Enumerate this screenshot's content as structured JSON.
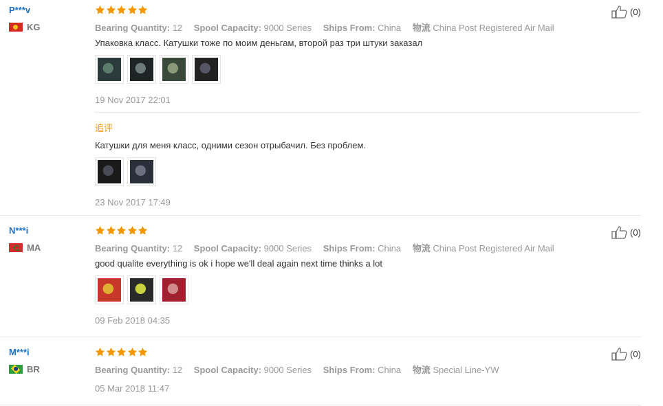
{
  "colors": {
    "star": "#f39800",
    "username": "#1a6fc4",
    "followup": "#f39800",
    "muted": "#999999"
  },
  "attr_labels": {
    "bearing": "Bearing Quantity:",
    "spool": "Spool Capacity:",
    "ships": "Ships From:",
    "logistics": "物流"
  },
  "reviews": [
    {
      "user": "P***v",
      "country": "KG",
      "rating": 5,
      "bearing": "12",
      "spool": "9000 Series",
      "ships": "China",
      "logistics": "China Post Registered Air Mail",
      "text": "Упаковка класс. Катушки тоже по моим деньгам, второй раз три штуки заказал",
      "photo_count": 4,
      "date": "19 Nov 2017 22:01",
      "helpful": "(0)",
      "followup": {
        "label": "追评",
        "text": "Катушки для меня класс, одними сезон отрыбачил. Без проблем.",
        "photo_count": 2,
        "date": "23 Nov 2017 17:49"
      }
    },
    {
      "user": "N***i",
      "country": "MA",
      "rating": 5,
      "bearing": "12",
      "spool": "9000 Series",
      "ships": "China",
      "logistics": "China Post Registered Air Mail",
      "text": "good qualite everything is ok i hope we'll deal again next time thinks a lot",
      "photo_count": 3,
      "date": "09 Feb 2018 04:35",
      "helpful": "(0)"
    },
    {
      "user": "M***i",
      "country": "BR",
      "rating": 5,
      "bearing": "12",
      "spool": "9000 Series",
      "ships": "China",
      "logistics": "Special Line-YW",
      "date": "05 Mar 2018 11:47",
      "helpful": "(0)"
    }
  ]
}
